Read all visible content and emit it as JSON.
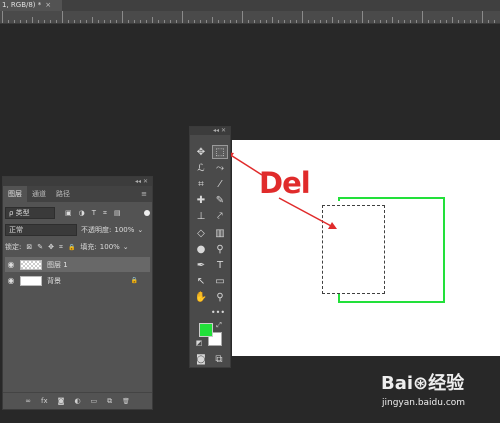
{
  "document": {
    "tab_title": "1, RGB/8) *",
    "tab_close": "×"
  },
  "annotation": {
    "key_label": "Del",
    "color": "#e02b2b"
  },
  "colors": {
    "foreground": "#22e03a",
    "background": "#ffffff",
    "shape_stroke": "#22e03a"
  },
  "toolbar": {
    "collapse": "◂◂ ✕",
    "tools": [
      {
        "name": "move-tool",
        "icon": "✥"
      },
      {
        "name": "marquee-tool",
        "icon": "⬚"
      },
      {
        "name": "lasso-tool",
        "icon": "ℒ"
      },
      {
        "name": "quick-select-tool",
        "icon": "⤳"
      },
      {
        "name": "crop-tool",
        "icon": "⌗"
      },
      {
        "name": "eyedropper-tool",
        "icon": "⁄"
      },
      {
        "name": "healing-tool",
        "icon": "✚"
      },
      {
        "name": "brush-tool",
        "icon": "✎"
      },
      {
        "name": "stamp-tool",
        "icon": "⊥"
      },
      {
        "name": "history-brush-tool",
        "icon": "⤤"
      },
      {
        "name": "eraser-tool",
        "icon": "◇"
      },
      {
        "name": "gradient-tool",
        "icon": "▥"
      },
      {
        "name": "blur-tool",
        "icon": "●"
      },
      {
        "name": "dodge-tool",
        "icon": "⚲"
      },
      {
        "name": "pen-tool",
        "icon": "✒"
      },
      {
        "name": "type-tool",
        "icon": "T"
      },
      {
        "name": "path-select-tool",
        "icon": "↖"
      },
      {
        "name": "shape-tool",
        "icon": "▭"
      },
      {
        "name": "hand-tool",
        "icon": "✋"
      },
      {
        "name": "zoom-tool",
        "icon": "⚲"
      }
    ],
    "more": "•••",
    "swap_icon": "⤢",
    "default_icon": "◩",
    "quickmask_icon": "◙",
    "screenmode_icon": "⧉"
  },
  "layers_panel": {
    "collapse": "◂◂ ✕",
    "tabs": [
      "图层",
      "通道",
      "路径"
    ],
    "menu_icon": "≡",
    "filter_label": "ρ 类型",
    "filter_icons": [
      "▣",
      "◑",
      "T",
      "⌗",
      "▤"
    ],
    "blend_mode": "正常",
    "opacity_label": "不透明度:",
    "opacity_value": "100%",
    "lock_label": "锁定:",
    "lock_icons": [
      "⊠",
      "✎",
      "✥",
      "⌗",
      "🔒"
    ],
    "fill_label": "填充:",
    "fill_value": "100%",
    "layers": [
      {
        "name": "图层 1",
        "selected": true,
        "lock": ""
      },
      {
        "name": "背景",
        "selected": false,
        "lock": "🔒"
      }
    ],
    "bottom_icons": [
      "∞",
      "fx",
      "◙",
      "◐",
      "▭",
      "⧉",
      "🗑"
    ]
  },
  "watermark": {
    "logo": "Bai⊛经验",
    "url": "jingyan.baidu.com"
  }
}
